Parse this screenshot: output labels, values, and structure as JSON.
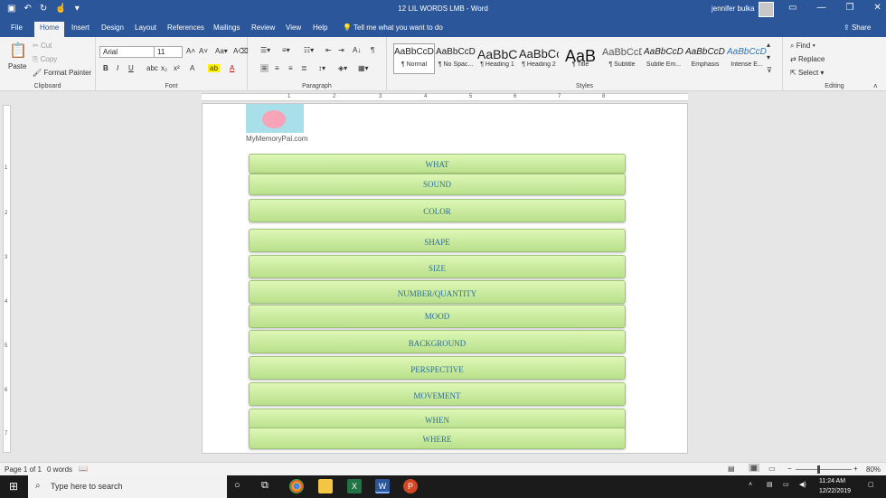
{
  "titlebar": {
    "title": "12 LIL WORDS LMB - Word",
    "user": "jennifer bulka"
  },
  "tabs": [
    "File",
    "Home",
    "Insert",
    "Design",
    "Layout",
    "References",
    "Mailings",
    "Review",
    "View",
    "Help"
  ],
  "tell_me": "Tell me what you want to do",
  "share": "Share",
  "clipboard": {
    "paste": "Paste",
    "cut": "Cut",
    "copy": "Copy",
    "format_painter": "Format Painter",
    "label": "Clipboard"
  },
  "font": {
    "name": "Arial",
    "size": "11",
    "label": "Font"
  },
  "paragraph": {
    "label": "Paragraph"
  },
  "styles": {
    "label": "Styles",
    "items": [
      {
        "preview": "AaBbCcDc",
        "name": "¶ Normal"
      },
      {
        "preview": "AaBbCcDc",
        "name": "¶ No Spac..."
      },
      {
        "preview": "AaBbC",
        "name": "¶ Heading 1"
      },
      {
        "preview": "AaBbCc",
        "name": "¶ Heading 2"
      },
      {
        "preview": "AaB",
        "name": "¶ Title"
      },
      {
        "preview": "AaBbCcD",
        "name": "¶ Subtitle"
      },
      {
        "preview": "AaBbCcDc",
        "name": "Subtle Em..."
      },
      {
        "preview": "AaBbCcDc",
        "name": "Emphasis"
      },
      {
        "preview": "AaBbCcDc",
        "name": "Intense E..."
      }
    ]
  },
  "editing": {
    "find": "Find",
    "replace": "Replace",
    "select": "Select",
    "label": "Editing"
  },
  "document": {
    "logo_caption": "MyMemoryPal.com",
    "bars": [
      "WHAT",
      "SOUND",
      "COLOR",
      "SHAPE",
      "SIZE",
      "NUMBER/QUANTITY",
      "MOOD",
      "BACKGROUND",
      "PERSPECTIVE",
      "MOVEMENT",
      "WHEN",
      "WHERE"
    ]
  },
  "status": {
    "page": "Page 1 of 1",
    "words": "0 words",
    "zoom": "80%"
  },
  "taskbar": {
    "search_placeholder": "Type here to search",
    "time": "11:24 AM",
    "date": "12/22/2019"
  }
}
